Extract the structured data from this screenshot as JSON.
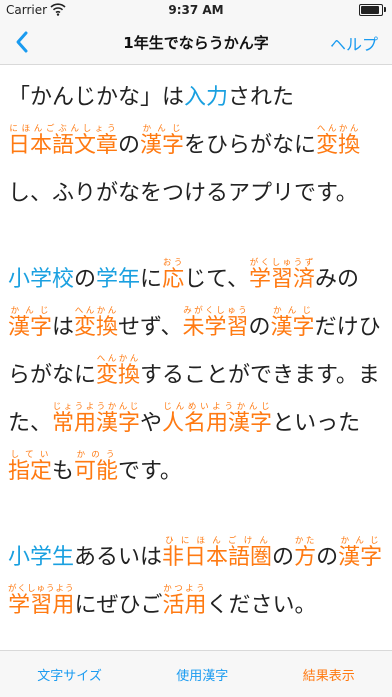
{
  "status": {
    "carrier": "Carrier",
    "time": "9:37 AM",
    "battery_fraction": 0.9
  },
  "nav": {
    "title": "1年生でならうかん字",
    "help": "ヘルプ",
    "back_icon": "chevron-left-icon"
  },
  "colors": {
    "accent_blue": "#1a9bf0",
    "kanji_orange": "#ff7a12"
  },
  "paragraphs": [
    {
      "lines": [
        [
          {
            "t": "「かんじかな」は"
          },
          {
            "t": "入力",
            "b": 1
          },
          {
            "t": "された"
          }
        ],
        [
          {
            "t": "日本語文章",
            "r": "にほんごぶんしょう",
            "k": 1
          },
          {
            "t": "の"
          },
          {
            "t": "漢字",
            "r": "かんじ",
            "k": 1
          },
          {
            "t": "をひらがなに"
          },
          {
            "t": "変換",
            "r": "へんかん",
            "k": 1
          }
        ],
        [
          {
            "t": "し、ふりがなをつけるアプリです。"
          }
        ]
      ]
    },
    {
      "lines": [
        [
          {
            "t": "小学校",
            "b": 1
          },
          {
            "t": "の"
          },
          {
            "t": "学年",
            "b": 1
          },
          {
            "t": "に"
          },
          {
            "t": "応",
            "r": "おう",
            "k": 1
          },
          {
            "t": "じて、"
          },
          {
            "t": "学習済",
            "r": "がくしゅうず",
            "k": 1
          },
          {
            "t": "みの"
          }
        ],
        [
          {
            "t": "漢字",
            "r": "かんじ",
            "k": 1
          },
          {
            "t": "は"
          },
          {
            "t": "変換",
            "r": "へんかん",
            "k": 1
          },
          {
            "t": "せず、"
          },
          {
            "t": "未学習",
            "r": "みがくしゅう",
            "k": 1
          },
          {
            "t": "の"
          },
          {
            "t": "漢字",
            "r": "かんじ",
            "k": 1
          },
          {
            "t": "だけひ"
          }
        ],
        [
          {
            "t": "らがなに"
          },
          {
            "t": "変換",
            "r": "へんかん",
            "k": 1
          },
          {
            "t": "することができます。ま"
          }
        ],
        [
          {
            "t": "た、"
          },
          {
            "t": "常用漢字",
            "r": "じょうようかんじ",
            "k": 1
          },
          {
            "t": "や"
          },
          {
            "t": "人名用漢字",
            "r": "じんめいようかんじ",
            "k": 1
          },
          {
            "t": "といった"
          }
        ],
        [
          {
            "t": "指定",
            "r": "してい",
            "k": 1
          },
          {
            "t": "も"
          },
          {
            "t": "可能",
            "r": "かのう",
            "k": 1
          },
          {
            "t": "です。"
          }
        ]
      ]
    },
    {
      "lines": [
        [
          {
            "t": "小学生",
            "b": 1
          },
          {
            "t": "あるいは"
          },
          {
            "t": "非日本語圏",
            "r": "ひにほんごけん",
            "k": 1
          },
          {
            "t": "の"
          },
          {
            "t": "方",
            "r": "かた",
            "k": 1
          },
          {
            "t": "の"
          },
          {
            "t": "漢字",
            "r": "かんじ",
            "k": 1
          }
        ],
        [
          {
            "t": "学習用",
            "r": "がくしゅうよう",
            "k": 1
          },
          {
            "t": "にぜひご"
          },
          {
            "t": "活用",
            "r": "かつよう",
            "k": 1
          },
          {
            "t": "ください。"
          }
        ]
      ]
    }
  ],
  "tabs": {
    "font_size": "文字サイズ",
    "kanji_used": "使用漢字",
    "show_result": "結果表示"
  }
}
